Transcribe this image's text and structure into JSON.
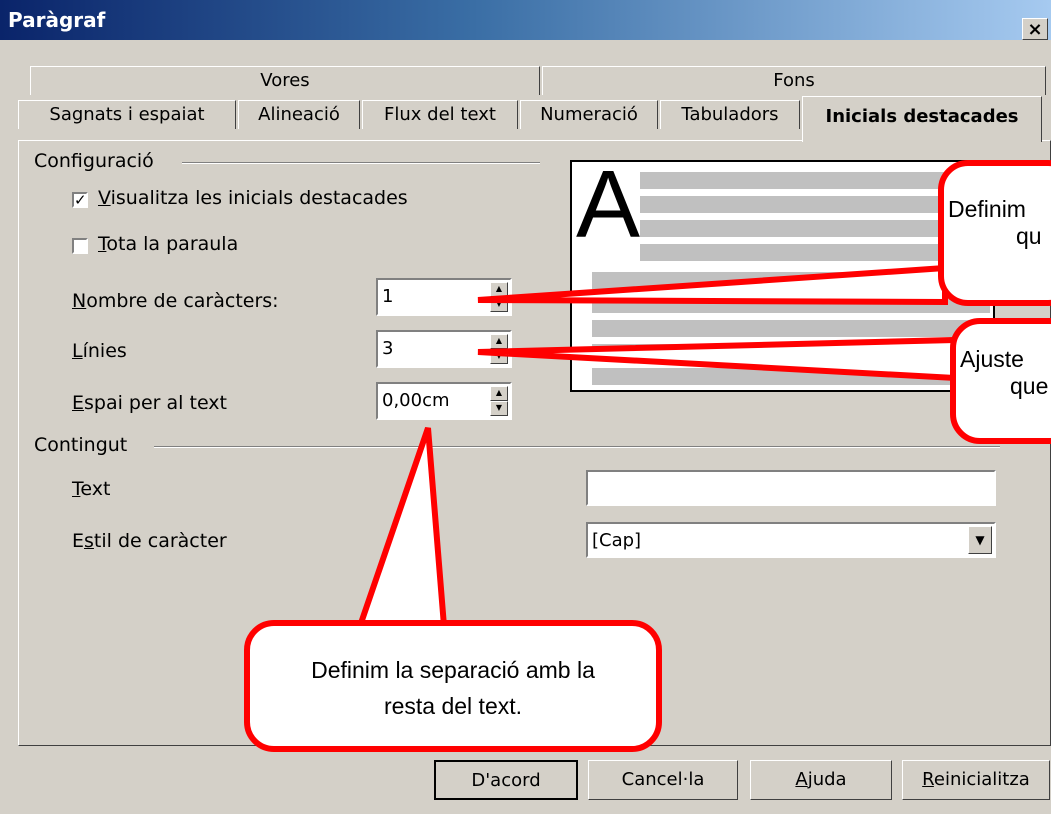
{
  "window": {
    "title": "Paràgraf",
    "close_label": "×"
  },
  "tabs_top": [
    {
      "label": "Vores"
    },
    {
      "label": "Fons"
    }
  ],
  "tabs_bottom": [
    {
      "label": "Sagnats i espaiat"
    },
    {
      "label": "Alineació"
    },
    {
      "label": "Flux del text"
    },
    {
      "label": "Numeració"
    },
    {
      "label": "Tabuladors"
    },
    {
      "label": "Inicials destacades"
    }
  ],
  "config": {
    "heading": "Configuració",
    "show_dropcaps": {
      "u": "V",
      "rest": "isualitza les inicials destacades",
      "checked": true,
      "mark": "✓"
    },
    "whole_word": {
      "u": "T",
      "rest": "ota la paraula",
      "checked": false
    },
    "num_chars": {
      "u": "N",
      "rest": "ombre de caràcters:",
      "value": "1"
    },
    "lines": {
      "u": "L",
      "rest": "ínies",
      "value": "3"
    },
    "space": {
      "u": "E",
      "rest": "spai per al text",
      "value": "0,00cm"
    }
  },
  "contents": {
    "heading": "Contingut",
    "text_label": {
      "u": "T",
      "rest": "ext"
    },
    "text_value": "",
    "charstyle_label": {
      "pre": "E",
      "u": "s",
      "rest": "til de caràcter"
    },
    "charstyle_value": "[Cap]"
  },
  "preview": {
    "letter": "A"
  },
  "callouts": {
    "top": {
      "line1": "Definim",
      "line2": "qu"
    },
    "middle": {
      "line1": "Ajuste",
      "line2": "que"
    },
    "bottom": {
      "line1": "Definim la separació amb la",
      "line2": "resta del text."
    }
  },
  "buttons": {
    "ok": "D'acord",
    "cancel": "Cancel·la",
    "help": {
      "u": "A",
      "rest": "juda"
    },
    "reset": {
      "u": "R",
      "rest": "einicialitza"
    }
  },
  "colors": {
    "callout_border": "#ff0000",
    "title_bar_start": "#0a246a",
    "title_bar_end": "#a6caf0"
  }
}
